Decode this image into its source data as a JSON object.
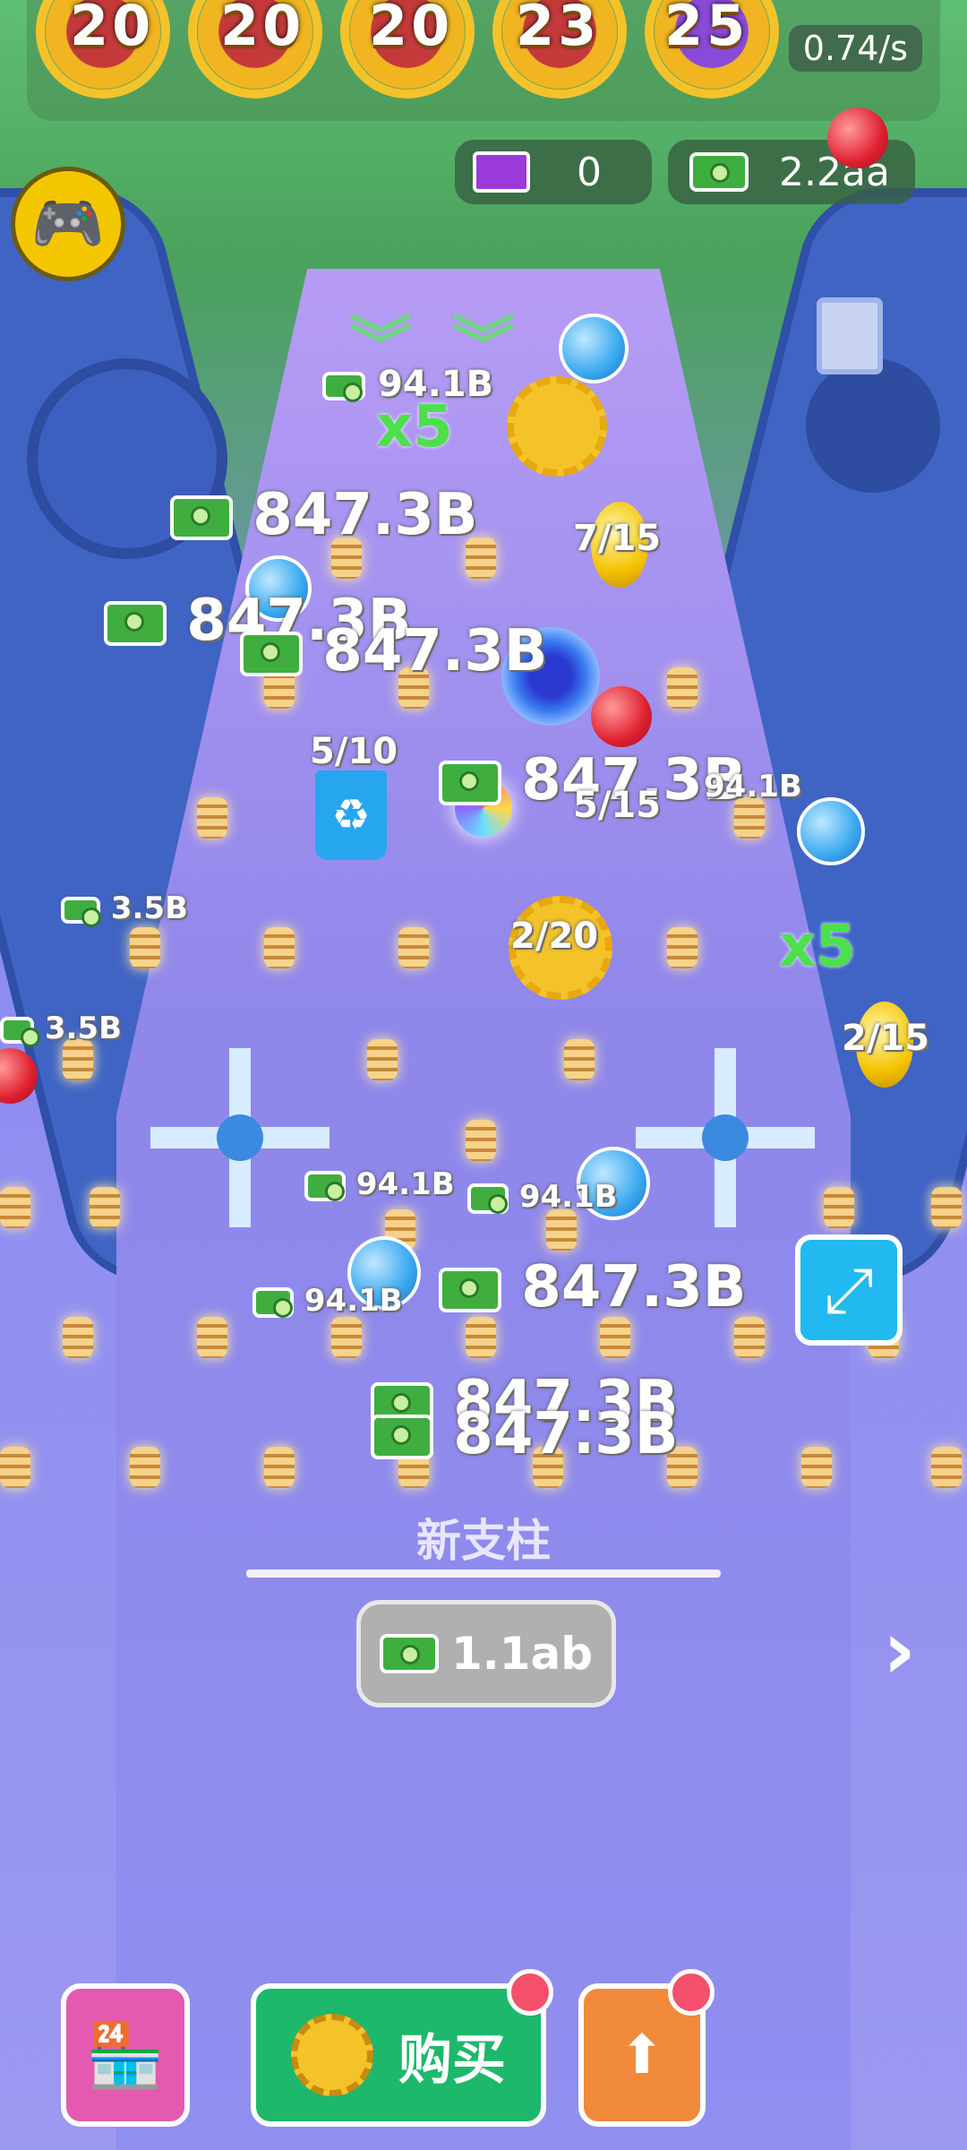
{
  "top": {
    "gears": [
      "20",
      "20",
      "20",
      "23",
      "25"
    ],
    "rate": "0.74/s"
  },
  "currency": {
    "tickets": "0",
    "cash": "2.2aa"
  },
  "board": {
    "labels": {
      "l1": "94.1B",
      "l2": "847.3B",
      "l3": "847.3B",
      "l4": "847.3B",
      "l5": "847.3B",
      "l6": "94.1B",
      "l7": "3.5B",
      "l8": "3.5B",
      "l9": "94.1B",
      "l10": "94.1B",
      "l11": "94.1B",
      "l12": "847.3B",
      "l13": "847.3B",
      "l14": "847.3B"
    },
    "counters": {
      "c1": "7/15",
      "c2": "5/10",
      "c3": "5/15",
      "c4": "2/20",
      "c5": "2/15"
    },
    "multipliers": {
      "m1": "x5",
      "m2": "x5"
    }
  },
  "new_post": {
    "label": "新支柱",
    "price": "1.1ab"
  },
  "bottom": {
    "buy_label": "购买"
  },
  "icons": [
    "gamepad-icon",
    "ticket-icon",
    "cash-icon",
    "trash-icon",
    "recycle-icon",
    "gear-icon",
    "shop-icon",
    "upgrade-icon",
    "swap-icon",
    "chevron-right-icon"
  ],
  "colors": {
    "board": "#9c98f0",
    "buy": "#1db86b",
    "shop": "#e45ab0",
    "upgrade": "#f08a3a",
    "gear": "#f4c32a"
  }
}
